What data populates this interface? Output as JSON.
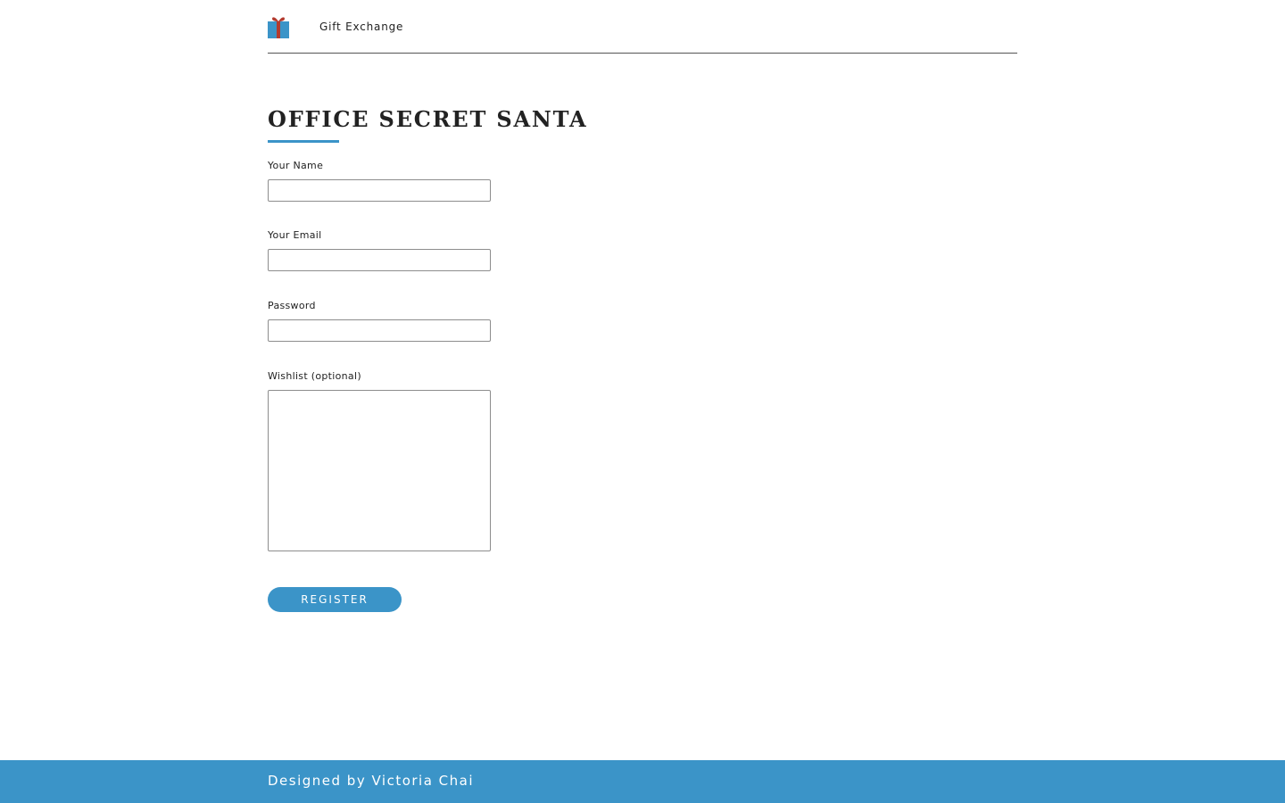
{
  "header": {
    "brand": "Gift Exchange",
    "logo_icon": "gift-icon"
  },
  "main": {
    "title": "OFFICE SECRET SANTA",
    "form": {
      "name_label": "Your Name",
      "name_value": "",
      "email_label": "Your Email",
      "email_value": "",
      "password_label": "Password",
      "password_value": "",
      "wishlist_label": "Wishlist (optional)",
      "wishlist_value": "",
      "submit_label": "REGISTER"
    }
  },
  "footer": {
    "credit": "Designed by Victoria Chai"
  },
  "colors": {
    "accent": "#3b94c8",
    "gift_box": "#3b94c8",
    "gift_ribbon": "#b33a2e",
    "text": "#222222"
  }
}
